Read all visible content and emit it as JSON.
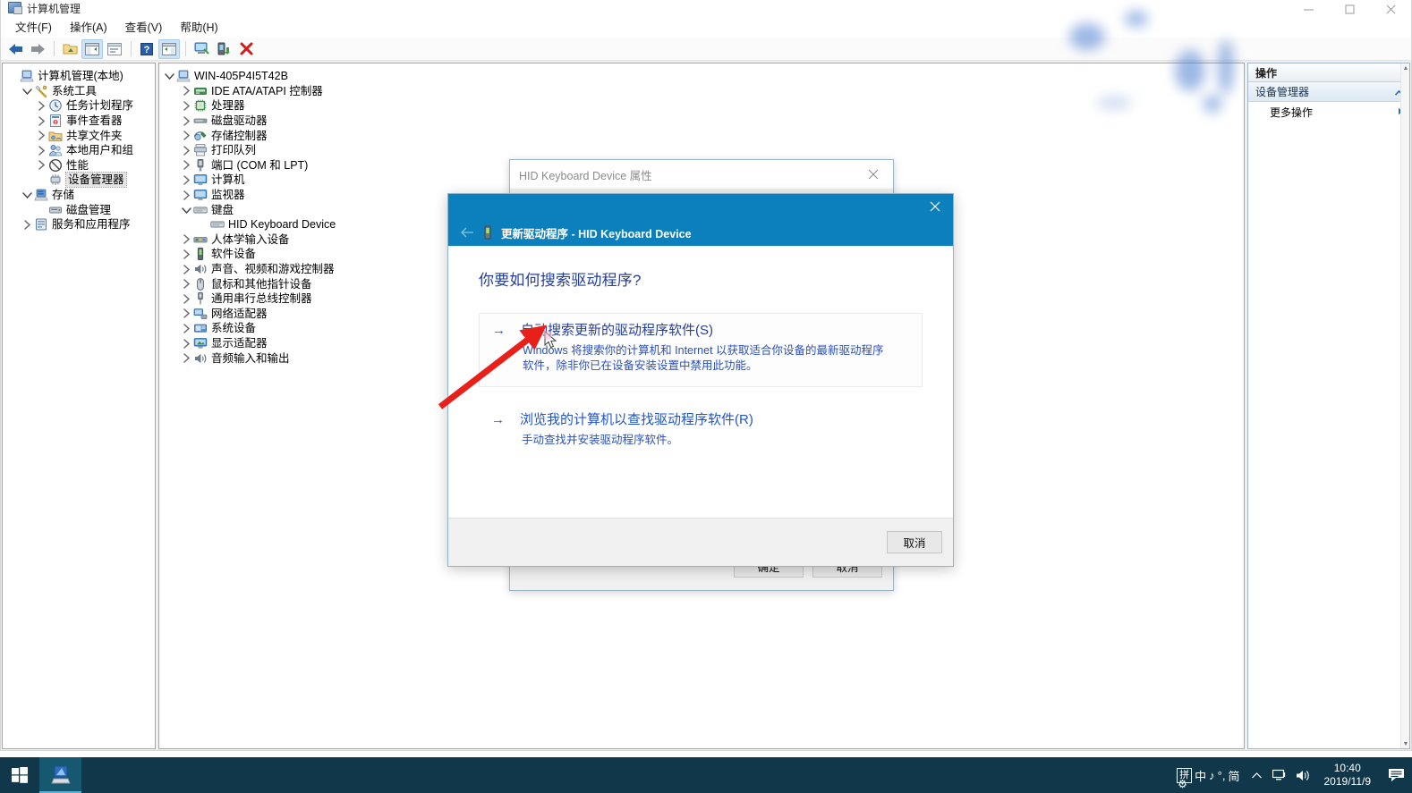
{
  "window": {
    "title": "计算机管理",
    "controls": {
      "minimize": "minimize-icon",
      "maximize": "maximize-icon",
      "close": "close-icon"
    }
  },
  "menubar": {
    "items": [
      {
        "label": "文件(F)",
        "name": "menu-file"
      },
      {
        "label": "操作(A)",
        "name": "menu-action"
      },
      {
        "label": "查看(V)",
        "name": "menu-view"
      },
      {
        "label": "帮助(H)",
        "name": "menu-help"
      }
    ]
  },
  "toolbar": {
    "buttons": [
      {
        "icon": "back-arrow-icon",
        "active": false
      },
      {
        "icon": "forward-arrow-icon",
        "active": false
      },
      {
        "icon": "folder-up-icon",
        "active": false
      },
      {
        "icon": "show-hide-console-tree-icon",
        "active": true
      },
      {
        "icon": "properties-icon",
        "active": false
      },
      {
        "icon": "help-icon",
        "active": false
      },
      {
        "icon": "show-action-pane-icon",
        "active": true
      },
      {
        "icon": "scan-hardware-icon",
        "active": false
      },
      {
        "icon": "update-driver-icon",
        "active": false
      },
      {
        "icon": "uninstall-device-icon",
        "active": false
      }
    ]
  },
  "sidebar": {
    "items": [
      {
        "label": "计算机管理(本地)",
        "indent": 0,
        "twist": "none",
        "icon": "computer-management-icon",
        "selected": false
      },
      {
        "label": "系统工具",
        "indent": 1,
        "twist": "expanded",
        "icon": "system-tools-icon",
        "selected": false
      },
      {
        "label": "任务计划程序",
        "indent": 2,
        "twist": "collapsed",
        "icon": "task-scheduler-icon",
        "selected": false
      },
      {
        "label": "事件查看器",
        "indent": 2,
        "twist": "collapsed",
        "icon": "event-viewer-icon",
        "selected": false
      },
      {
        "label": "共享文件夹",
        "indent": 2,
        "twist": "collapsed",
        "icon": "shared-folders-icon",
        "selected": false
      },
      {
        "label": "本地用户和组",
        "indent": 2,
        "twist": "collapsed",
        "icon": "local-users-groups-icon",
        "selected": false
      },
      {
        "label": "性能",
        "indent": 2,
        "twist": "collapsed",
        "icon": "performance-icon",
        "selected": false
      },
      {
        "label": "设备管理器",
        "indent": 2,
        "twist": "none",
        "icon": "device-manager-icon",
        "selected": true
      },
      {
        "label": "存储",
        "indent": 1,
        "twist": "expanded",
        "icon": "storage-icon",
        "selected": false
      },
      {
        "label": "磁盘管理",
        "indent": 2,
        "twist": "none",
        "icon": "disk-management-icon",
        "selected": false
      },
      {
        "label": "服务和应用程序",
        "indent": 1,
        "twist": "collapsed",
        "icon": "services-apps-icon",
        "selected": false
      }
    ]
  },
  "device_tree": {
    "items": [
      {
        "label": "WIN-405P4I5T42B",
        "indent": 0,
        "twist": "expanded",
        "icon": "computer-node-icon"
      },
      {
        "label": "IDE ATA/ATAPI 控制器",
        "indent": 1,
        "twist": "collapsed",
        "icon": "ide-controller-icon"
      },
      {
        "label": "处理器",
        "indent": 1,
        "twist": "collapsed",
        "icon": "processor-icon"
      },
      {
        "label": "磁盘驱动器",
        "indent": 1,
        "twist": "collapsed",
        "icon": "disk-drive-icon"
      },
      {
        "label": "存储控制器",
        "indent": 1,
        "twist": "collapsed",
        "icon": "storage-controller-icon"
      },
      {
        "label": "打印队列",
        "indent": 1,
        "twist": "collapsed",
        "icon": "print-queue-icon"
      },
      {
        "label": "端口 (COM 和 LPT)",
        "indent": 1,
        "twist": "collapsed",
        "icon": "ports-icon"
      },
      {
        "label": "计算机",
        "indent": 1,
        "twist": "collapsed",
        "icon": "computer-icon"
      },
      {
        "label": "监视器",
        "indent": 1,
        "twist": "collapsed",
        "icon": "monitor-icon"
      },
      {
        "label": "键盘",
        "indent": 1,
        "twist": "expanded",
        "icon": "keyboard-icon"
      },
      {
        "label": "HID Keyboard Device",
        "indent": 2,
        "twist": "none",
        "icon": "keyboard-device-icon"
      },
      {
        "label": "人体学输入设备",
        "indent": 1,
        "twist": "collapsed",
        "icon": "hid-icon"
      },
      {
        "label": "软件设备",
        "indent": 1,
        "twist": "collapsed",
        "icon": "software-device-icon"
      },
      {
        "label": "声音、视频和游戏控制器",
        "indent": 1,
        "twist": "collapsed",
        "icon": "sound-video-game-icon"
      },
      {
        "label": "鼠标和其他指针设备",
        "indent": 1,
        "twist": "collapsed",
        "icon": "mouse-icon"
      },
      {
        "label": "通用串行总线控制器",
        "indent": 1,
        "twist": "collapsed",
        "icon": "usb-controller-icon"
      },
      {
        "label": "网络适配器",
        "indent": 1,
        "twist": "collapsed",
        "icon": "network-adapter-icon"
      },
      {
        "label": "系统设备",
        "indent": 1,
        "twist": "collapsed",
        "icon": "system-device-icon"
      },
      {
        "label": "显示适配器",
        "indent": 1,
        "twist": "collapsed",
        "icon": "display-adapter-icon"
      },
      {
        "label": "音频输入和输出",
        "indent": 1,
        "twist": "collapsed",
        "icon": "audio-io-icon"
      }
    ]
  },
  "actions_pane": {
    "header": "操作",
    "group": "设备管理器",
    "group_collapse_icon": "chevron-up-icon",
    "items": [
      {
        "label": "更多操作",
        "submenu_icon": "chevron-right-icon"
      }
    ]
  },
  "properties_dialog": {
    "title": "HID Keyboard Device 属性",
    "close_icon": "close-icon",
    "buttons": [
      {
        "label": "确定",
        "name": "ok-button"
      },
      {
        "label": "取消",
        "name": "cancel-button"
      }
    ]
  },
  "wizard": {
    "nav_title": "更新驱动程序 - HID Keyboard Device",
    "device_icon": "keyboard-device-icon",
    "back_icon": "back-arrow-icon",
    "close_icon": "close-icon",
    "heading": "你要如何搜索驱动程序?",
    "options": [
      {
        "title": "自动搜索更新的驱动程序软件(S)",
        "desc": "Windows 将搜索你的计算机和 Internet 以获取适合你设备的最新驱动程序软件，除非你已在设备安装设置中禁用此功能。",
        "focused": true,
        "name": "option-auto-search"
      },
      {
        "title": "浏览我的计算机以查找驱动程序软件(R)",
        "desc": "手动查找并安装驱动程序软件。",
        "focused": false,
        "name": "option-browse-computer"
      }
    ],
    "cancel_label": "取消"
  },
  "taskbar": {
    "start_icon": "windows-start-icon",
    "apps": [
      {
        "icon": "computer-management-icon",
        "name": "taskbar-app-computer-management",
        "active": true
      }
    ],
    "ime": {
      "mode_box": "拼",
      "lang": "中",
      "punct": "♪",
      "symbol": "°,",
      "script": "简",
      "gear_icon": "gear-icon"
    },
    "tray": {
      "overflow_icon": "chevron-up-icon",
      "network_icon": "network-icon",
      "volume_icon": "volume-icon",
      "time": "10:40",
      "date": "2019/11/9",
      "action_center_icon": "action-center-icon"
    }
  },
  "colors": {
    "wizard_header": "#0c7fbd",
    "link_blue": "#2255cc",
    "heading_blue": "#26409a",
    "taskbar": "#11384a",
    "annotation_red": "#e8201a"
  }
}
